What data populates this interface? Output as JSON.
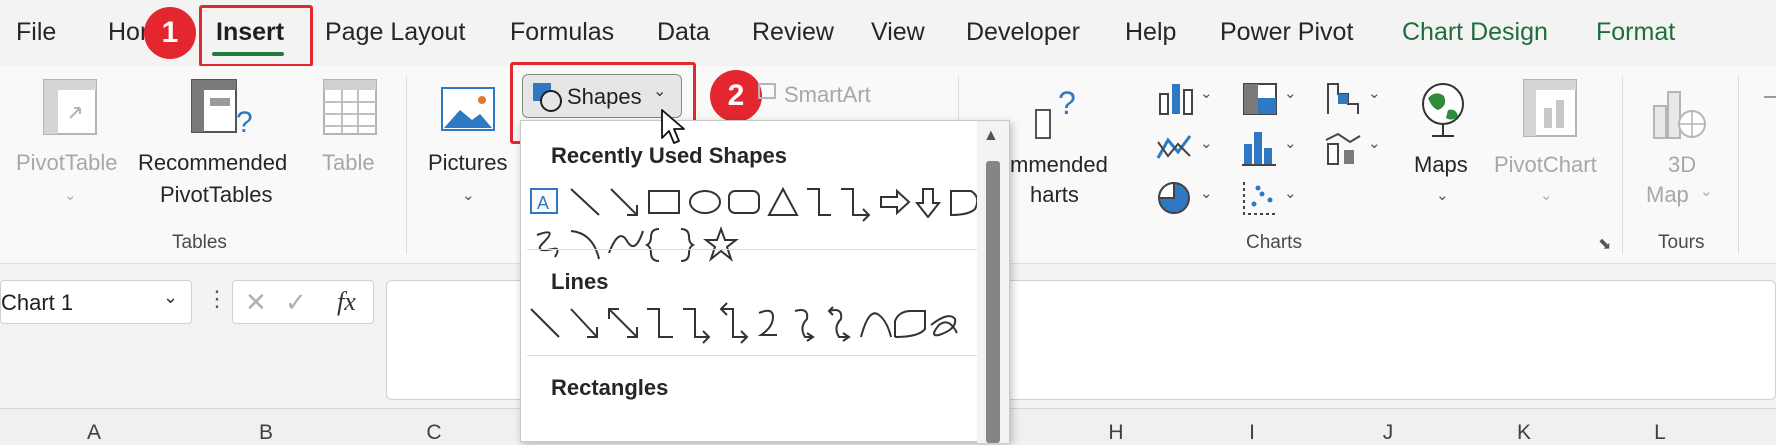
{
  "tabs": [
    {
      "label": "File"
    },
    {
      "label": "Home"
    },
    {
      "label": "Insert"
    },
    {
      "label": "Page Layout"
    },
    {
      "label": "Formulas"
    },
    {
      "label": "Data"
    },
    {
      "label": "Review"
    },
    {
      "label": "View"
    },
    {
      "label": "Developer"
    },
    {
      "label": "Help"
    },
    {
      "label": "Power Pivot"
    },
    {
      "label": "Chart Design"
    },
    {
      "label": "Format"
    }
  ],
  "callouts": {
    "step1": "1",
    "step2": "2"
  },
  "ribbon": {
    "pivottable": "PivotTable",
    "recommended_pivot_line1": "Recommended",
    "recommended_pivot_line2": "PivotTables",
    "table": "Table",
    "tables_group": "Tables",
    "pictures": "Pictures",
    "shapes": "Shapes",
    "smartart": "SmartArt",
    "recommended_charts_line1": "mmended",
    "recommended_charts_line2": "harts",
    "maps": "Maps",
    "pivotchart": "PivotChart",
    "map3d_line1": "3D",
    "map3d_line2": "Map",
    "charts_group": "Charts",
    "tours_group": "Tours"
  },
  "formula_bar": {
    "name_box": "Chart 1",
    "fx": "fx"
  },
  "shapes_menu": {
    "recently_used": "Recently Used Shapes",
    "lines": "Lines",
    "rectangles": "Rectangles"
  },
  "columns": [
    "A",
    "B",
    "C",
    "H",
    "I",
    "J",
    "K",
    "L"
  ],
  "colors": {
    "accent_red": "#e4262f",
    "insert_underline": "#1e7b3d",
    "chart_tabs": "#1e6d3a",
    "map_green": "#2e8b3a"
  }
}
